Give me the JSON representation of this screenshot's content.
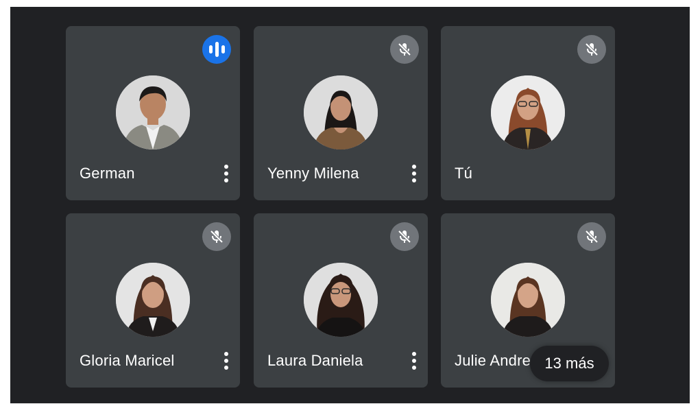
{
  "participants": [
    {
      "name": "German",
      "status": "speaking",
      "status_icon": "speaking-indicator-icon"
    },
    {
      "name": "Yenny Milena",
      "status": "muted",
      "status_icon": "mic-off-icon"
    },
    {
      "name": "Tú",
      "status": "muted",
      "status_icon": "mic-off-icon"
    },
    {
      "name": "Gloria Maricel",
      "status": "muted",
      "status_icon": "mic-off-icon"
    },
    {
      "name": "Laura Daniela",
      "status": "muted",
      "status_icon": "mic-off-icon"
    },
    {
      "name": "Julie Andrea",
      "status": "muted",
      "status_icon": "mic-off-icon"
    }
  ],
  "overflow": {
    "label": "13 más"
  },
  "colors": {
    "background": "#202124",
    "tile": "#3c4043",
    "speaking_accent": "#1a73e8",
    "mute_badge": "#71757a"
  }
}
